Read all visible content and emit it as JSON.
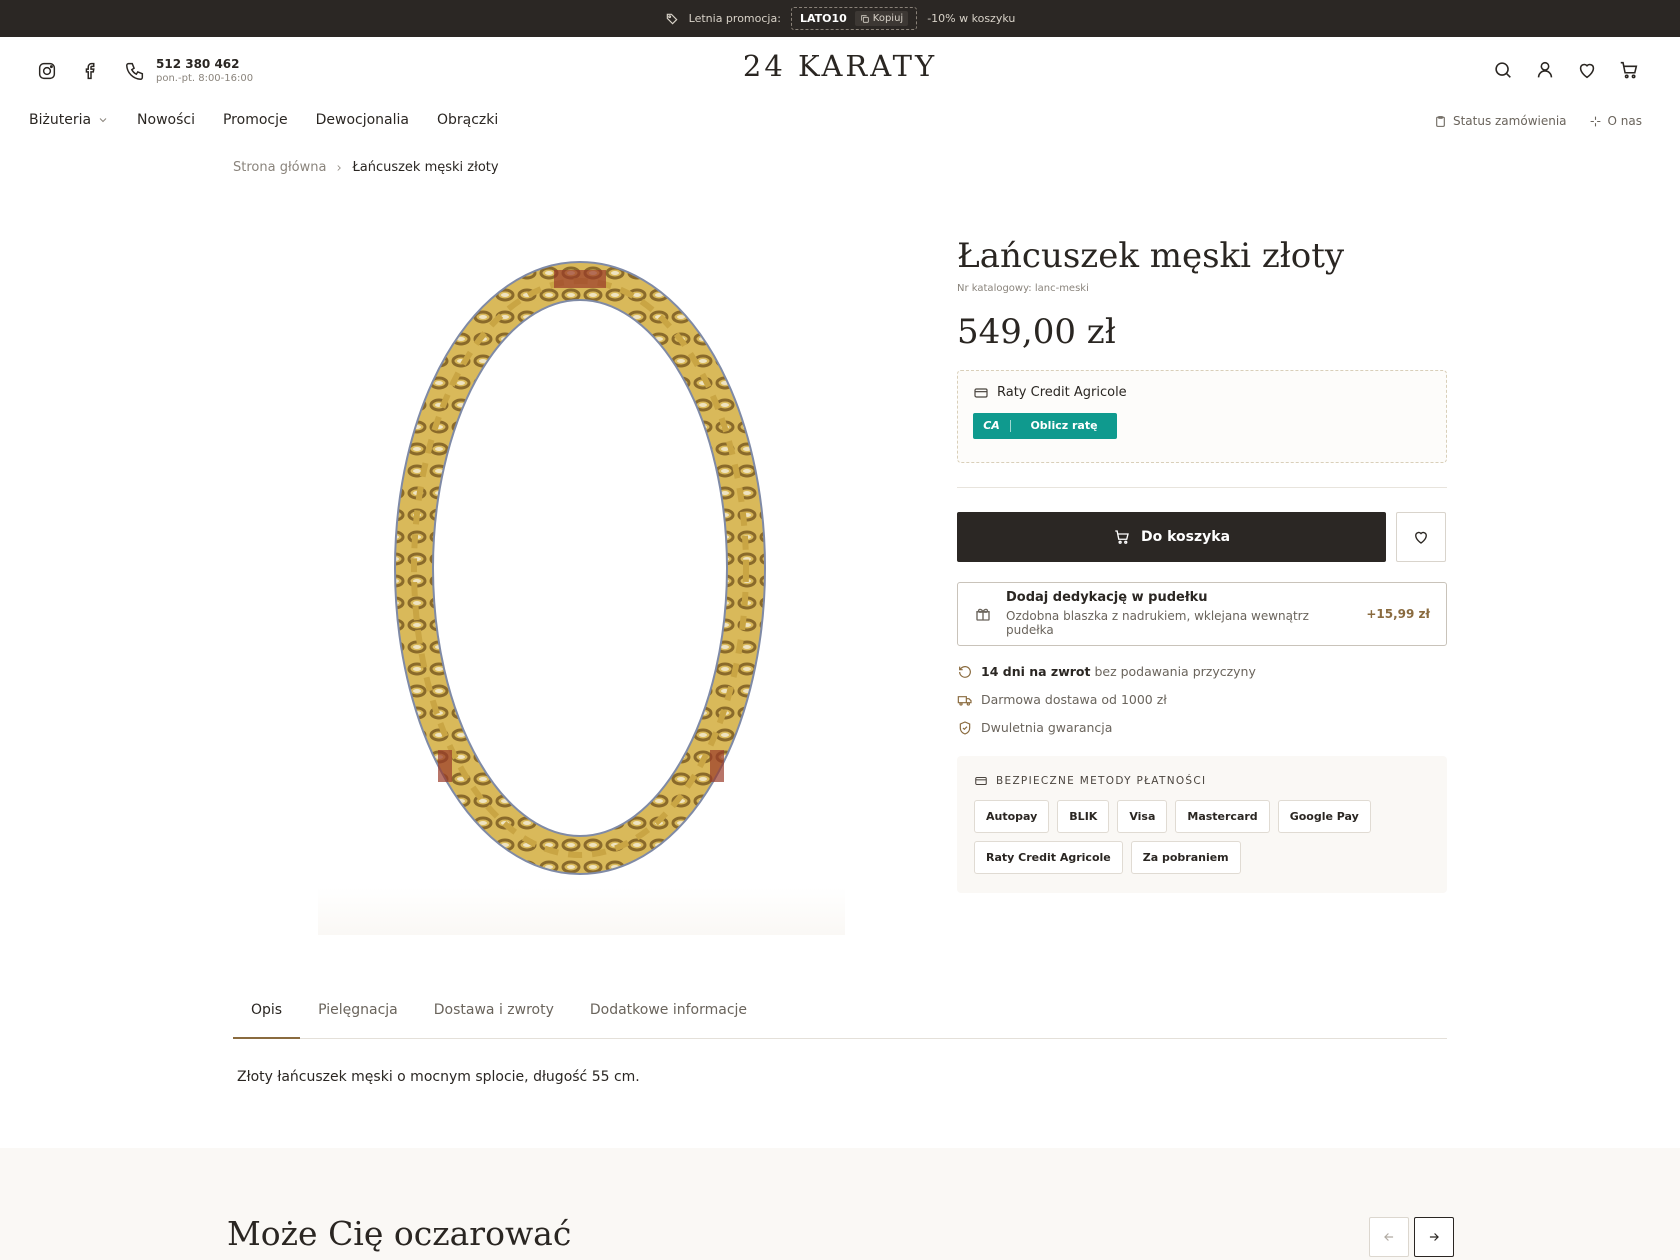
{
  "promo": {
    "label": "Letnia promocja:",
    "code": "LATO10",
    "copy_label": "Kopiuj",
    "discount": "-10% w koszyku"
  },
  "header": {
    "phone": "512 380 462",
    "hours": "pon.-pt. 8:00-16:00",
    "logo": "24 KARATY"
  },
  "nav": {
    "items": [
      "Biżuteria",
      "Nowości",
      "Promocje",
      "Dewocjonalia",
      "Obrączki"
    ],
    "right": [
      "Status zamówienia",
      "O nas"
    ]
  },
  "breadcrumb": {
    "home": "Strona główna",
    "current": "Łańcuszek męski złoty"
  },
  "product": {
    "title": "Łańcuszek męski złoty",
    "catalog": "Nr katalogowy: lanc-meski",
    "price": "549,00 zł",
    "credit_title": "Raty Credit Agricole",
    "credit_logo": "CA",
    "credit_button": "Oblicz ratę",
    "cart_button": "Do koszyka",
    "dedication_title": "Dodaj dedykację w pudełku",
    "dedication_sub": "Ozdobna blaszka z nadrukiem, wklejana wewnątrz pudełka",
    "dedication_price": "+15,99 zł",
    "feature_return_bold": "14 dni na zwrot",
    "feature_return_rest": " bez podawania przyczyny",
    "feature_delivery": "Darmowa dostawa od 1000 zł",
    "feature_warranty": "Dwuletnia gwarancja",
    "payment_title": "BEZPIECZNE METODY PŁATNOŚCI",
    "payment_methods": [
      "Autopay",
      "BLIK",
      "Visa",
      "Mastercard",
      "Google Pay",
      "Raty Credit Agricole",
      "Za pobraniem"
    ]
  },
  "tabs": {
    "items": [
      "Opis",
      "Pielęgnacja",
      "Dostawa i zwroty",
      "Dodatkowe informacje"
    ],
    "active": "Opis",
    "description": "Złoty łańcuszek męski o mocnym splocie, długość 55 cm."
  },
  "related": {
    "title": "Może Cię oczarować"
  },
  "colors": {
    "dark": "#2b2724",
    "accent": "#8a6b3f",
    "credit": "#0f9a8e",
    "gold": "#c9a544"
  }
}
